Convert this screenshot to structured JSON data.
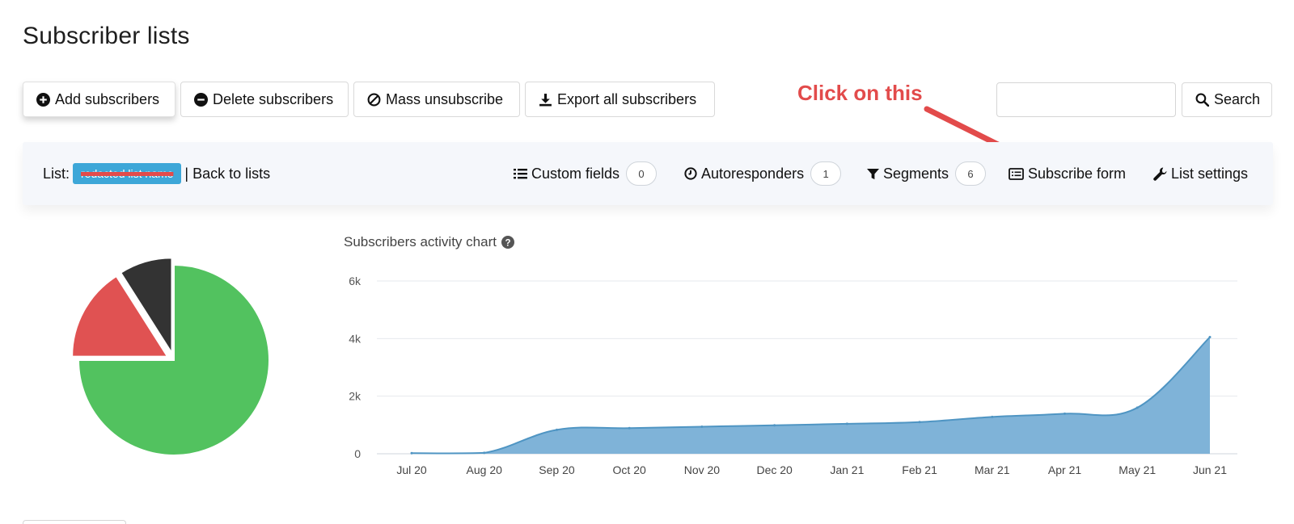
{
  "page": {
    "title": "Subscriber lists"
  },
  "toolbar": {
    "add_label": "Add subscribers",
    "delete_label": "Delete subscribers",
    "mass_unsub_label": "Mass unsubscribe",
    "export_label": "Export all subscribers",
    "search_value": "",
    "search_label": "Search"
  },
  "annotation": {
    "text": "Click on this",
    "color": "#e24b4b"
  },
  "listbar": {
    "list_prefix": "List:",
    "list_name": "redacted list name",
    "back_label": "| Back to lists",
    "custom_fields_label": "Custom fields",
    "custom_fields_count": "0",
    "autoresponders_label": "Autoresponders",
    "autoresponders_count": "1",
    "segments_label": "Segments",
    "segments_count": "6",
    "subscribe_form_label": "Subscribe form",
    "list_settings_label": "List settings"
  },
  "chart": {
    "title": "Subscribers activity chart"
  },
  "colors": {
    "area": "#7fb3d8",
    "area_line": "#4f95c3",
    "pie_green": "#52c25f",
    "pie_red": "#e05252",
    "pie_dark": "#333333",
    "list_badge": "#3da7d8"
  },
  "chart_data": [
    {
      "type": "pie",
      "slices": [
        {
          "label": "",
          "value": 75,
          "color": "#52c25f",
          "exploded": false
        },
        {
          "label": "",
          "value": 16,
          "color": "#e05252",
          "exploded": true
        },
        {
          "label": "",
          "value": 9,
          "color": "#333333",
          "exploded": true
        }
      ]
    },
    {
      "type": "area",
      "categories": [
        "Jul 20",
        "Aug 20",
        "Sep 20",
        "Oct 20",
        "Nov 20",
        "Dec 20",
        "Jan 21",
        "Feb 21",
        "Mar 21",
        "Apr 21",
        "May 21",
        "Jun 21"
      ],
      "values": [
        20,
        30,
        830,
        890,
        940,
        990,
        1040,
        1100,
        1280,
        1390,
        1600,
        4050
      ],
      "ylim": [
        0,
        6000
      ],
      "yticks": [
        {
          "value": 0,
          "label": "0"
        },
        {
          "value": 2000,
          "label": "2k"
        },
        {
          "value": 4000,
          "label": "4k"
        },
        {
          "value": 6000,
          "label": "6k"
        }
      ],
      "grid": true,
      "xlabel": "",
      "ylabel": ""
    }
  ]
}
